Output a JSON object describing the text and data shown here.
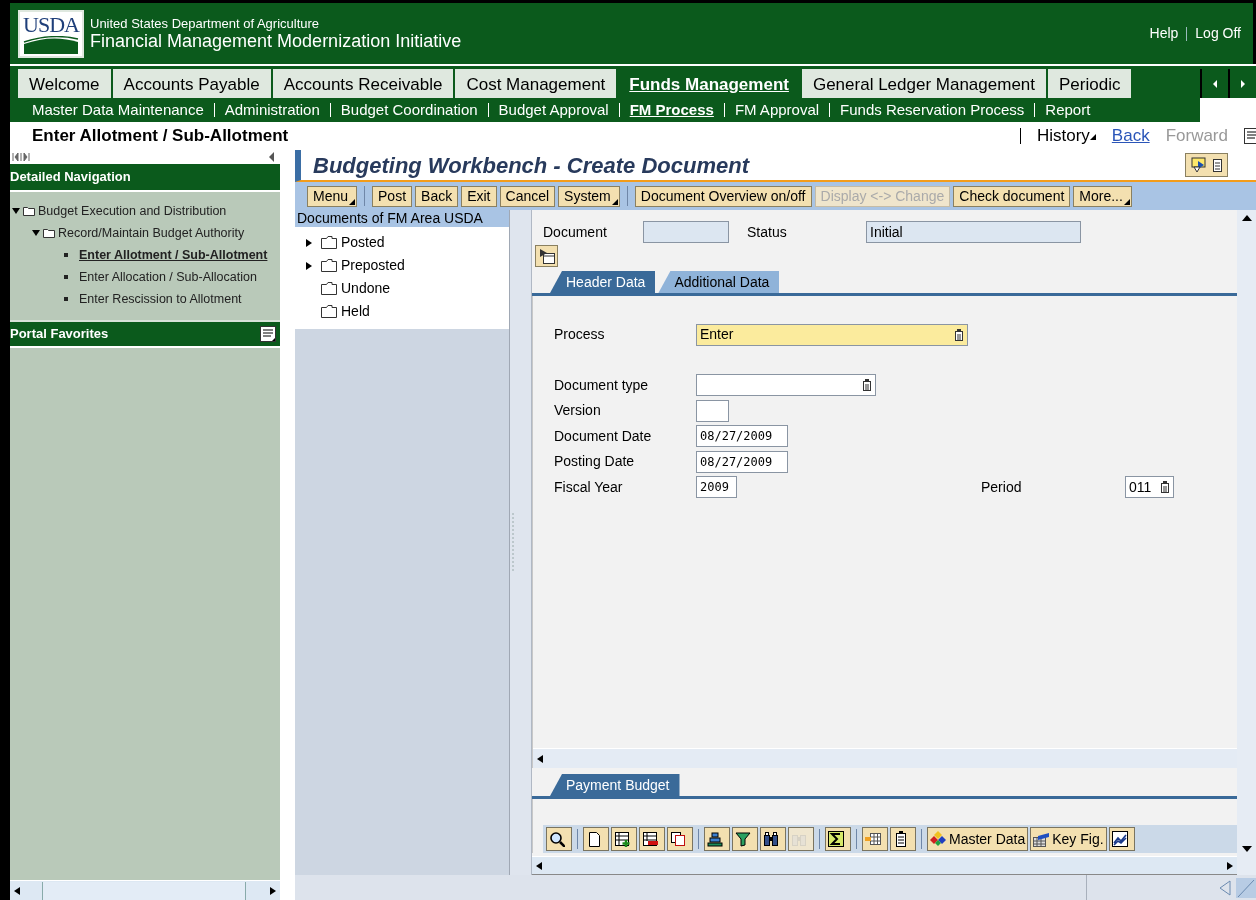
{
  "header": {
    "logo": "USDA",
    "agency": "United States Department of Agriculture",
    "initiative": "Financial Management Modernization Initiative",
    "links": [
      "Help",
      "Log Off"
    ]
  },
  "top_tabs": [
    {
      "label": "Welcome",
      "selected": false
    },
    {
      "label": "Accounts Payable",
      "selected": false
    },
    {
      "label": "Accounts Receivable",
      "selected": false
    },
    {
      "label": "Cost Management",
      "selected": false
    },
    {
      "label": "Funds Management",
      "selected": true
    },
    {
      "label": "General Ledger Management",
      "selected": false
    },
    {
      "label": "Periodic",
      "selected": false
    }
  ],
  "sub_tabs": [
    {
      "label": "Master Data Maintenance",
      "selected": false
    },
    {
      "label": "Administration",
      "selected": false
    },
    {
      "label": "Budget Coordination",
      "selected": false
    },
    {
      "label": "Budget Approval",
      "selected": false
    },
    {
      "label": "FM Process",
      "selected": true
    },
    {
      "label": "FM Approval",
      "selected": false
    },
    {
      "label": "Funds Reservation Process",
      "selected": false
    },
    {
      "label": "Report",
      "selected": false
    }
  ],
  "page_title": "Enter Allotment / Sub-Allotment",
  "history": [
    {
      "label": "History",
      "kind": "menu"
    },
    {
      "label": "Back",
      "kind": "link"
    },
    {
      "label": "Forward",
      "kind": "disabled"
    }
  ],
  "nav": {
    "title": "Detailed Navigation",
    "favorites_title": "Portal Favorites",
    "tree": [
      {
        "label": "Budget Execution and Distribution",
        "expanded": true,
        "children": [
          {
            "label": "Record/Maintain Budget Authority",
            "expanded": true,
            "children": [
              {
                "label": "Enter Allotment / Sub-Allotment",
                "selected": true
              },
              {
                "label": "Enter Allocation / Sub-Allocation",
                "selected": false
              },
              {
                "label": "Enter Rescission to Allotment",
                "selected": false
              }
            ]
          }
        ]
      }
    ]
  },
  "workbench": {
    "title": "Budgeting Workbench - Create Document",
    "toolbar": [
      {
        "label": "Menu",
        "kind": "menu",
        "disabled": false
      },
      {
        "kind": "separator"
      },
      {
        "label": "Post",
        "kind": "button",
        "disabled": false
      },
      {
        "label": "Back",
        "kind": "button",
        "disabled": false
      },
      {
        "label": "Exit",
        "kind": "button",
        "disabled": false
      },
      {
        "label": "Cancel",
        "kind": "button",
        "disabled": false
      },
      {
        "label": "System",
        "kind": "menu",
        "disabled": false
      },
      {
        "kind": "separator"
      },
      {
        "label": "Document Overview on/off",
        "kind": "button",
        "disabled": false
      },
      {
        "label": "Display <-> Change",
        "kind": "button",
        "disabled": true
      },
      {
        "label": "Check document",
        "kind": "button",
        "disabled": false
      },
      {
        "label": "More...",
        "kind": "menu",
        "disabled": false
      }
    ],
    "doc_tree": {
      "title": "Documents of FM Area USDA",
      "folders": [
        {
          "label": "Posted",
          "expandable": true
        },
        {
          "label": "Preposted",
          "expandable": true
        },
        {
          "label": "Undone",
          "expandable": false
        },
        {
          "label": "Held",
          "expandable": false
        }
      ]
    },
    "summary": [
      {
        "label": "Document"
      },
      {
        "label": "Status",
        "value": "Initial"
      }
    ],
    "tabs": [
      {
        "label": "Header Data",
        "selected": true
      },
      {
        "label": "Additional Data",
        "selected": false
      }
    ],
    "rows": [
      [
        {
          "label": "Process",
          "value": "Enter",
          "kind": "select",
          "highlighted": true
        }
      ],
      [
        {
          "label": "Document type",
          "kind": "select",
          "highlighted": false
        }
      ],
      [
        {
          "label": "Version",
          "kind": "text",
          "highlighted": false
        }
      ],
      [
        {
          "label": "Document Date",
          "value": "08/27/2009",
          "kind": "text",
          "highlighted": false
        }
      ],
      [
        {
          "label": "Posting Date",
          "value": "08/27/2009",
          "kind": "text",
          "highlighted": false
        }
      ],
      [
        {
          "label": "Fiscal Year",
          "value": "2009",
          "kind": "text",
          "highlighted": false
        },
        {
          "label": "Period",
          "value": "011",
          "kind": "select",
          "highlighted": false
        }
      ]
    ],
    "bottom_tabs": [
      {
        "label": "Payment Budget",
        "selected": true
      }
    ],
    "grid_toolbar": [
      {
        "kind": "icon",
        "disabled": false
      },
      {
        "kind": "separator"
      },
      {
        "kind": "icon",
        "disabled": false
      },
      {
        "kind": "icon",
        "disabled": false
      },
      {
        "kind": "icon",
        "disabled": false
      },
      {
        "kind": "icon",
        "disabled": false
      },
      {
        "kind": "separator"
      },
      {
        "kind": "icon",
        "disabled": false
      },
      {
        "kind": "icon",
        "disabled": false
      },
      {
        "kind": "icon",
        "disabled": false
      },
      {
        "kind": "icon",
        "disabled": true
      },
      {
        "kind": "separator"
      },
      {
        "kind": "icon",
        "disabled": false
      },
      {
        "kind": "separator"
      },
      {
        "kind": "icon",
        "disabled": false
      },
      {
        "kind": "icon",
        "disabled": false
      },
      {
        "kind": "separator"
      },
      {
        "kind": "labeled",
        "label": "Master Data",
        "disabled": false
      },
      {
        "kind": "labeled",
        "label": "Key Fig.",
        "disabled": false
      },
      {
        "kind": "icon",
        "disabled": false
      }
    ]
  }
}
